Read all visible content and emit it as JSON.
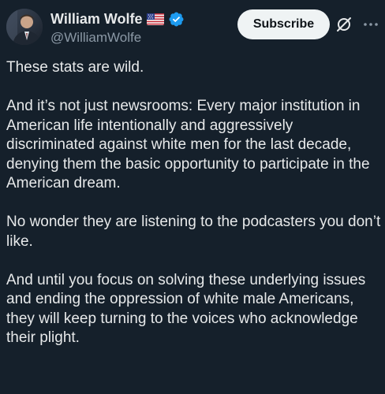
{
  "author": {
    "display_name": "William Wolfe",
    "handle": "@WilliamWolfe",
    "flag_icon": "us-flag-icon",
    "verified_icon": "verified-badge-icon",
    "verified_color": "#1d9bf0"
  },
  "actions": {
    "subscribe_label": "Subscribe",
    "grok_icon": "grok-icon",
    "more_icon": "more-options-icon"
  },
  "tweet": {
    "paragraphs": [
      "These stats are wild.",
      "And it’s not just newsrooms: Every major institution in American life intentionally and aggressively discriminated against white men for the last decade, denying them the basic opportunity to participate in the American dream.",
      "No wonder they are listening to the podcasters you don’t like.",
      "And until you focus on solving these underlying issues and ending the oppression of white male Americans, they will keep turning to the voices who acknowledge their plight."
    ]
  },
  "theme": {
    "background": "#15202b",
    "text": "#e7e9ea",
    "secondary_text": "#8b98a5",
    "button_bg": "#eff3f4"
  }
}
